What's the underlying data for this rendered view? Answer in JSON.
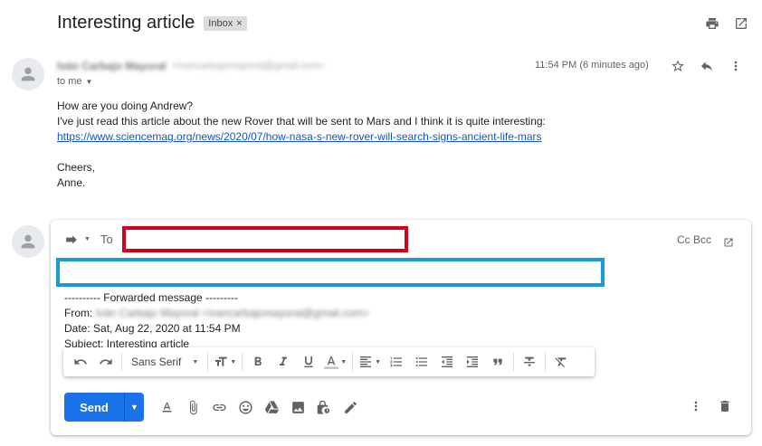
{
  "email": {
    "subject": "Interesting article",
    "label": "Inbox",
    "label_remove": "×",
    "sender_name": "Iván Carbajo Mayoral",
    "sender_email": "<ivancarbajomayoral@gmail.com>",
    "to_me": "to me",
    "time": "11:54 PM (6 minutes ago)",
    "body_line1": "How are you doing Andrew?",
    "body_line2": "I've just read this article about the new Rover that will be sent to Mars and I think it is quite interesting: ",
    "body_link": "https://www.sciencemag.org/news/2020/07/how-nasa-s-new-rover-will-search-signs-ancient-life-mars",
    "closing": "Cheers,",
    "signature": "Anne."
  },
  "compose": {
    "to_label": "To",
    "cc_bcc": "Cc Bcc",
    "forwarded_header": "---------- Forwarded message ---------",
    "from_label": "From: ",
    "from_value": "Iván Carbajo Mayoral <ivancarbajomayoral@gmail.com>",
    "date_line": "Date: Sat, Aug 22, 2020 at 11:54 PM",
    "subject_line": "Subject: Interesting article",
    "font_name": "Sans Serif",
    "send_label": "Send"
  },
  "colors": {
    "to_highlight": "#d0021b",
    "body_highlight": "#1a9ad6",
    "send_button": "#1a73e8",
    "link": "#1155cc"
  },
  "icons": [
    "print-icon",
    "open-new-window-icon",
    "star-icon",
    "reply-icon",
    "more-vert-icon",
    "forward-arrow-icon",
    "undo-icon",
    "redo-icon",
    "text-size-icon",
    "bold-icon",
    "italic-icon",
    "underline-icon",
    "text-color-icon",
    "align-icon",
    "numbered-list-icon",
    "bulleted-list-icon",
    "indent-less-icon",
    "indent-more-icon",
    "quote-icon",
    "strikethrough-icon",
    "remove-formatting-icon",
    "formatting-options-icon",
    "attach-icon",
    "link-icon",
    "emoji-icon",
    "drive-icon",
    "photo-icon",
    "confidential-icon",
    "signature-icon",
    "discard-icon"
  ]
}
